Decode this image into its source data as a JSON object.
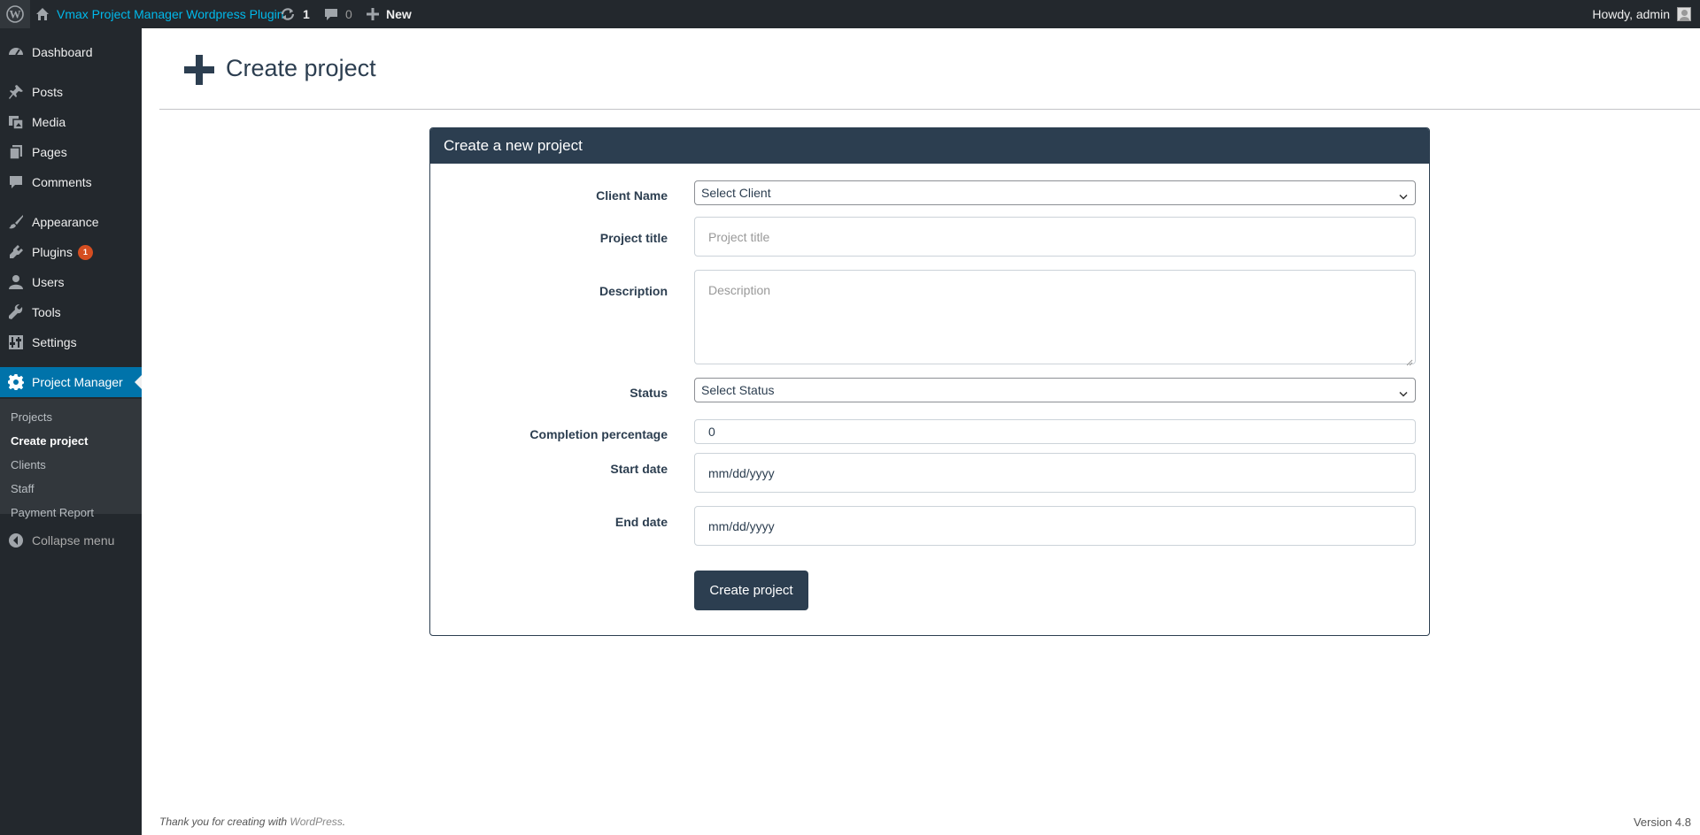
{
  "admin_bar": {
    "site_name": "Vmax Project Manager Wordpress Plugin",
    "updates_count": "1",
    "comments_count": "0",
    "new_label": "New",
    "howdy": "Howdy, admin"
  },
  "sidebar": {
    "items": [
      {
        "label": "Dashboard",
        "icon": "dashboard-icon"
      },
      {
        "label": "Posts",
        "icon": "pin-icon"
      },
      {
        "label": "Media",
        "icon": "media-icon"
      },
      {
        "label": "Pages",
        "icon": "pages-icon"
      },
      {
        "label": "Comments",
        "icon": "comment-icon"
      },
      {
        "label": "Appearance",
        "icon": "brush-icon"
      },
      {
        "label": "Plugins",
        "icon": "plug-icon",
        "badge": "1"
      },
      {
        "label": "Users",
        "icon": "user-icon"
      },
      {
        "label": "Tools",
        "icon": "wrench-icon"
      },
      {
        "label": "Settings",
        "icon": "settings-icon"
      },
      {
        "label": "Project Manager",
        "icon": "gear-icon"
      }
    ],
    "submenu": [
      "Projects",
      "Create project",
      "Clients",
      "Staff",
      "Payment Report"
    ],
    "collapse_label": "Collapse menu"
  },
  "page": {
    "title": "Create project"
  },
  "form": {
    "panel_title": "Create a new project",
    "client_label": "Client Name",
    "client_value": "Select Client",
    "title_label": "Project title",
    "title_placeholder": "Project title",
    "description_label": "Description",
    "description_placeholder": "Description",
    "status_label": "Status",
    "status_value": "Select Status",
    "completion_label": "Completion percentage",
    "completion_value": "0",
    "start_label": "Start date",
    "start_value": "mm/dd/yyyy",
    "end_label": "End date",
    "end_value": "mm/dd/yyyy",
    "submit_label": "Create project"
  },
  "footer": {
    "thanks_prefix": "Thank you for creating with ",
    "wordpress_link": "WordPress",
    "thanks_suffix": ".",
    "version": "Version 4.8"
  },
  "colors": {
    "admin_bar_bg": "#23282d",
    "site_link": "#00b9eb",
    "current_menu": "#0073aa",
    "panel_head": "#2c3e50",
    "badge": "#d54e21"
  }
}
